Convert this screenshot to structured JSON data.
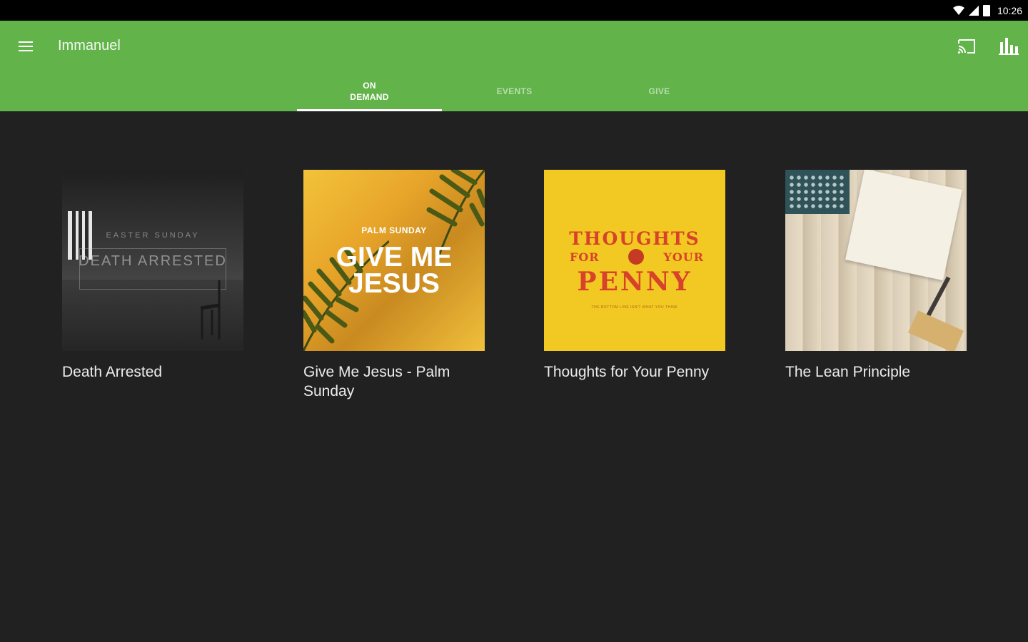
{
  "status_bar": {
    "time": "10:26"
  },
  "app_bar": {
    "title": "Immanuel",
    "tabs": [
      {
        "label": "ON DEMAND",
        "active": true
      },
      {
        "label": "EVENTS",
        "active": false
      },
      {
        "label": "GIVE",
        "active": false
      }
    ],
    "accent": "#62b34a"
  },
  "series": [
    {
      "title": "Death Arrested",
      "art_subtitle": "EASTER SUNDAY",
      "art_title": "DEATH ARRESTED"
    },
    {
      "title": "Give Me Jesus - Palm Sunday",
      "art_subtitle": "PALM SUNDAY",
      "art_title": "GIVE ME JESUS"
    },
    {
      "title": "Thoughts for Your Penny",
      "art_line1": "THOUGHTS",
      "art_line2a": "FOR",
      "art_line2b": "YOUR",
      "art_line3": "PENNY",
      "art_small": "THE BOTTOM LINE ISN'T WHAT YOU THINK"
    },
    {
      "title": "The Lean Principle"
    }
  ]
}
